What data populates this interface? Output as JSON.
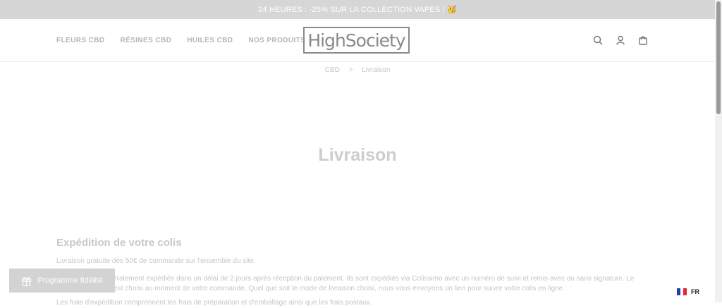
{
  "announcement": "24 HEURES : -25% SUR LA COLLECTION VAPES ! 🥳",
  "nav": [
    {
      "label": "FLEURS CBD"
    },
    {
      "label": "RÉSINES CBD"
    },
    {
      "label": "HUILES CBD"
    },
    {
      "label": "NOS PRODUITS",
      "has_dropdown": true
    }
  ],
  "logo_text": "HighSociety",
  "icons": [
    "search-icon",
    "account-icon",
    "cart-icon"
  ],
  "breadcrumb": {
    "root": "CBD",
    "separator": ">",
    "current": "Livraison"
  },
  "page_title": "Livraison",
  "section_title": "Expédition de votre colis",
  "paragraphs": [
    "Livraison gratuite dès 50€ de commande sur l'ensemble du site.",
    "Les colis sont généralement expédiés dans un délai de 2 jours après réception du paiement. Ils sont expédiés via Colissimo avec un numéro de suivi et remis avec ou sans signature. Le mode de livraison est choisi au moment de votre commande. Quel que soit le mode de livraison choisi, nous vous envoyons un lien pour suivre votre colis en ligne.",
    "Les frais d'expédition comprennent les frais de préparation et d'emballage ainsi que les frais postaux."
  ],
  "fidelity_button": "Programme fidélité",
  "language": "FR",
  "colors": {
    "announce_bg": "#d6d6d6",
    "nav_text": "#b5b5b5",
    "logo": "#8a8a8a"
  }
}
